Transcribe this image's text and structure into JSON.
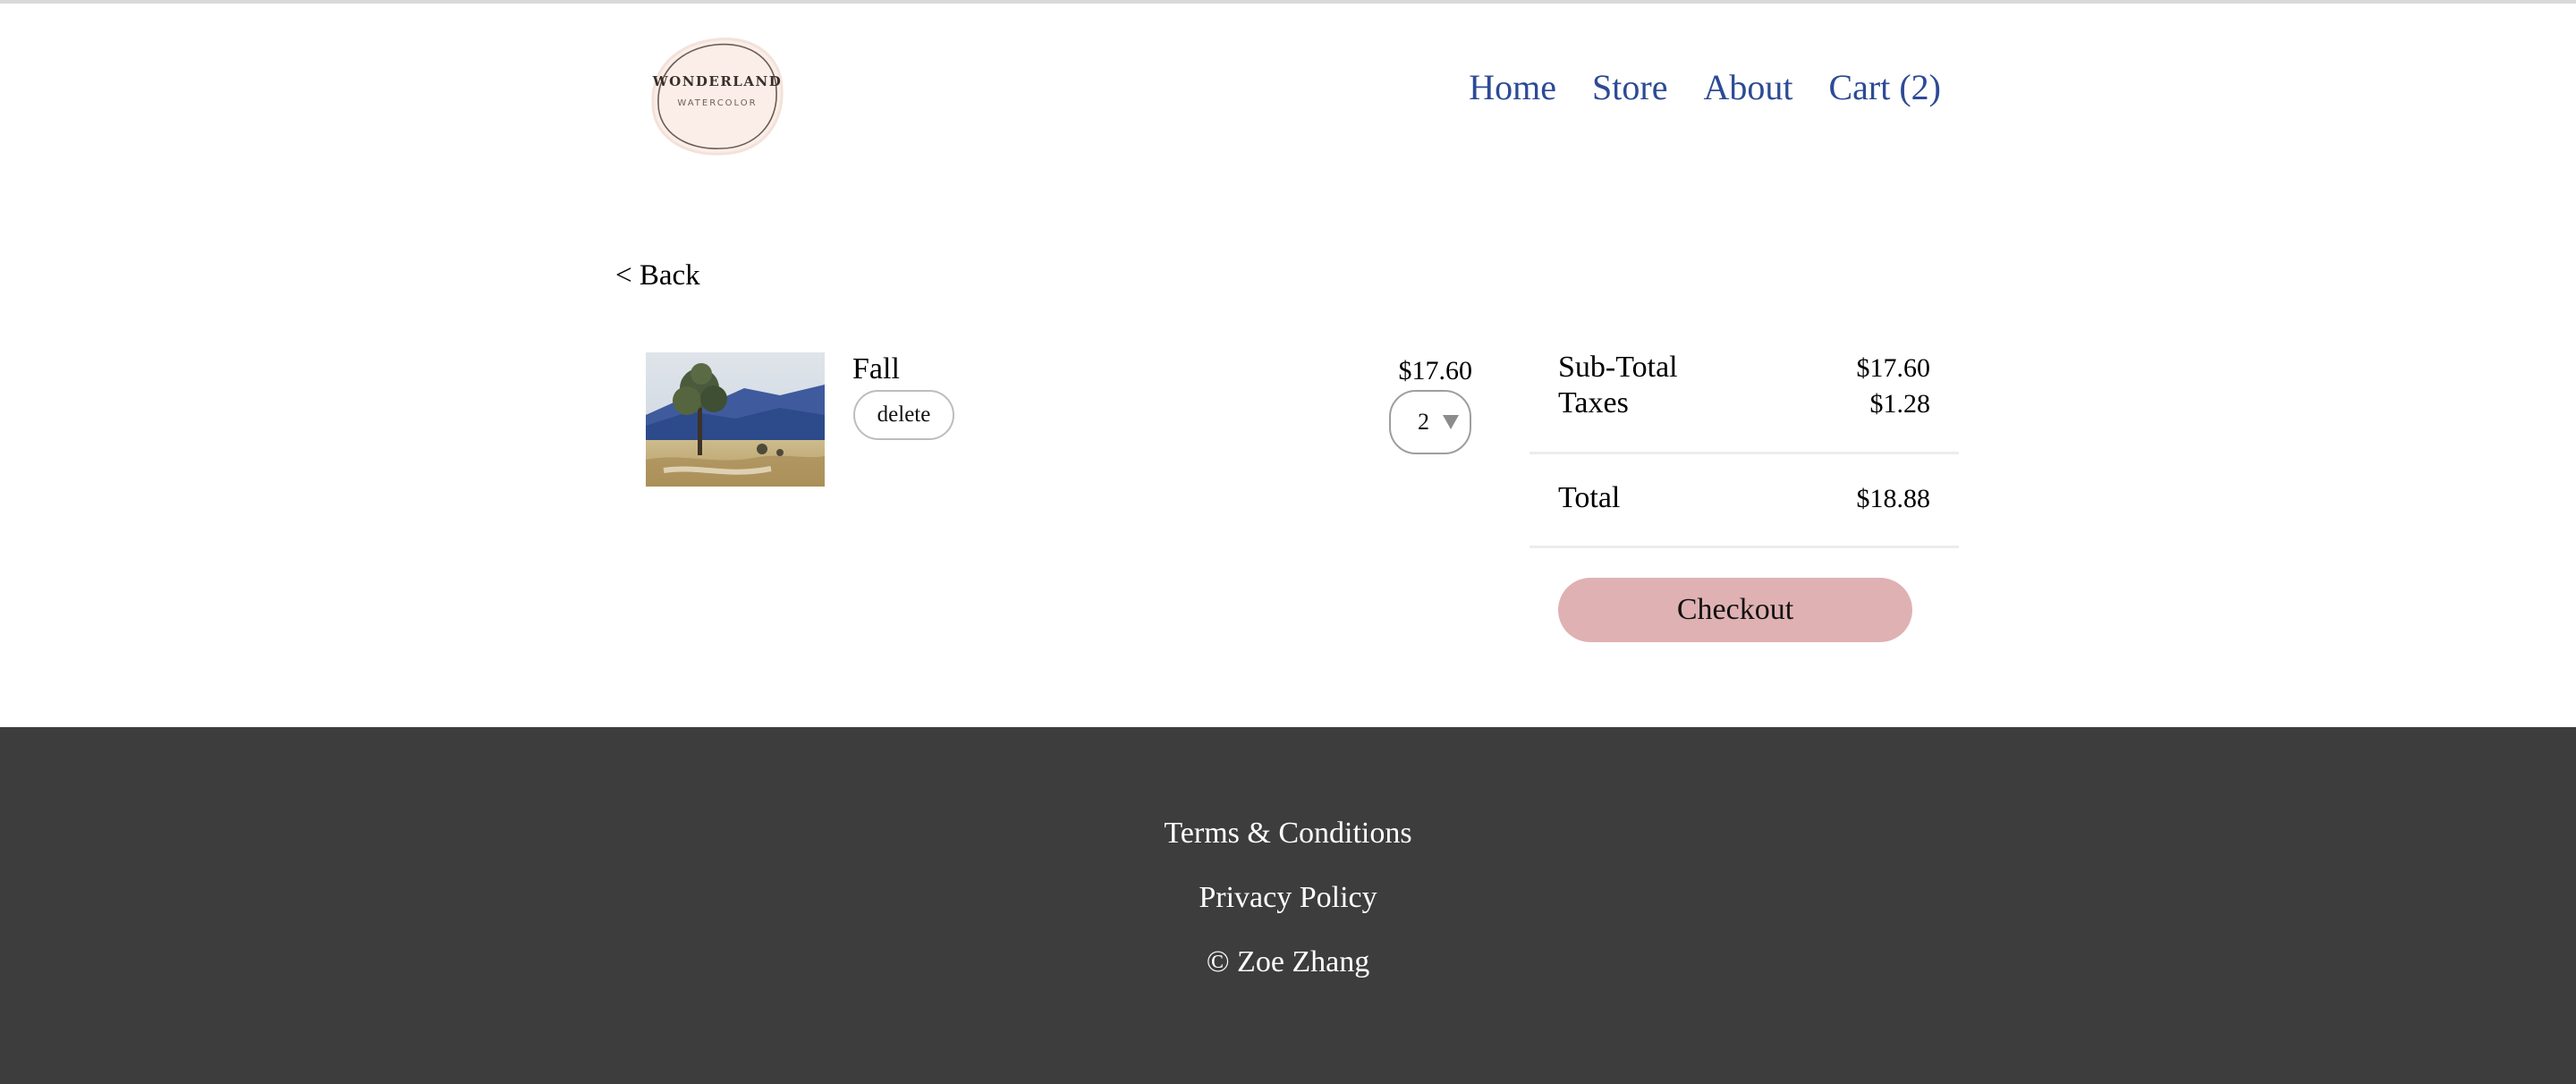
{
  "header": {
    "logo_title": "WONDERLAND",
    "logo_subtitle": "WATERCOLOR",
    "nav": [
      {
        "label": "Home"
      },
      {
        "label": "Store"
      },
      {
        "label": "About"
      },
      {
        "label": "Cart (2)"
      }
    ]
  },
  "back_label": "< Back",
  "cart_item": {
    "name": "Fall",
    "delete_label": "delete",
    "price": "$17.60",
    "quantity": "2",
    "thumbnail_icon": "landscape-painting-image"
  },
  "summary": {
    "subtotal_label": "Sub-Total",
    "subtotal_value": "$17.60",
    "taxes_label": "Taxes",
    "taxes_value": "$1.28",
    "total_label": "Total",
    "total_value": "$18.88",
    "checkout_label": "Checkout"
  },
  "footer": {
    "terms": "Terms & Conditions",
    "privacy": "Privacy Policy",
    "copyright": "© Zoe Zhang"
  },
  "colors": {
    "nav_link": "#2c4a96",
    "checkout_button": "#dfb1b2",
    "footer_bg": "#3d3d3d",
    "logo_bg": "#fbeee8"
  }
}
